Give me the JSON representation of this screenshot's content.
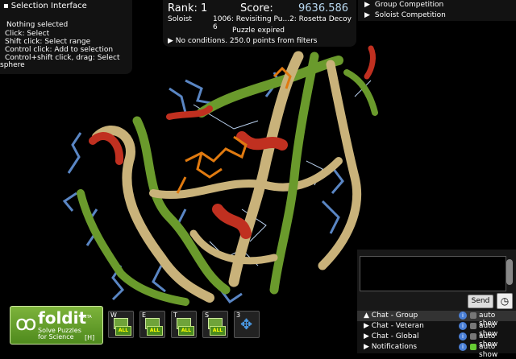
{
  "selection": {
    "title": "Selection Interface",
    "lines": [
      "Nothing selected",
      "Click: Select",
      "Shift click: Select range",
      "Control click: Add to selection",
      "Control+shift click, drag: Select",
      "sphere"
    ]
  },
  "score": {
    "rank_label": "Rank: 1",
    "score_label": "Score:",
    "score_value": "9636.586",
    "mode": "Soloist",
    "puzzle": "1006: Revisiting Pu...2: Rosetta Decoy 6",
    "status": "Puzzle expired",
    "conditions": "No conditions. 250.0 points from filters"
  },
  "competition": [
    "Group Competition",
    "Soloist Competition"
  ],
  "chat": {
    "send": "Send",
    "channels": [
      {
        "label": "Chat - Group",
        "auto": "auto show",
        "expanded": true
      },
      {
        "label": "Chat - Veteran",
        "auto": "auto show",
        "expanded": false
      },
      {
        "label": "Chat - Global",
        "auto": "auto show",
        "expanded": false
      },
      {
        "label": "Notifications",
        "auto": "auto show",
        "expanded": false
      }
    ]
  },
  "logo": {
    "name": "foldit",
    "beta": "BETA",
    "tagline1": "Solve Puzzles",
    "tagline2": "for Science",
    "hotkey": "[H]"
  },
  "tools": [
    {
      "key": "W",
      "badge": "ALL"
    },
    {
      "key": "E",
      "badge": "ALL"
    },
    {
      "key": "T",
      "badge": "ALL"
    },
    {
      "key": "S",
      "badge": "ALL"
    },
    {
      "key": "3",
      "badge": ""
    }
  ],
  "colors": {
    "panel": "#141414",
    "green": "#6a9a2c",
    "tan": "#c9b27a",
    "red": "#c03020",
    "blue": "#5a86c4",
    "orange": "#e07a10"
  }
}
